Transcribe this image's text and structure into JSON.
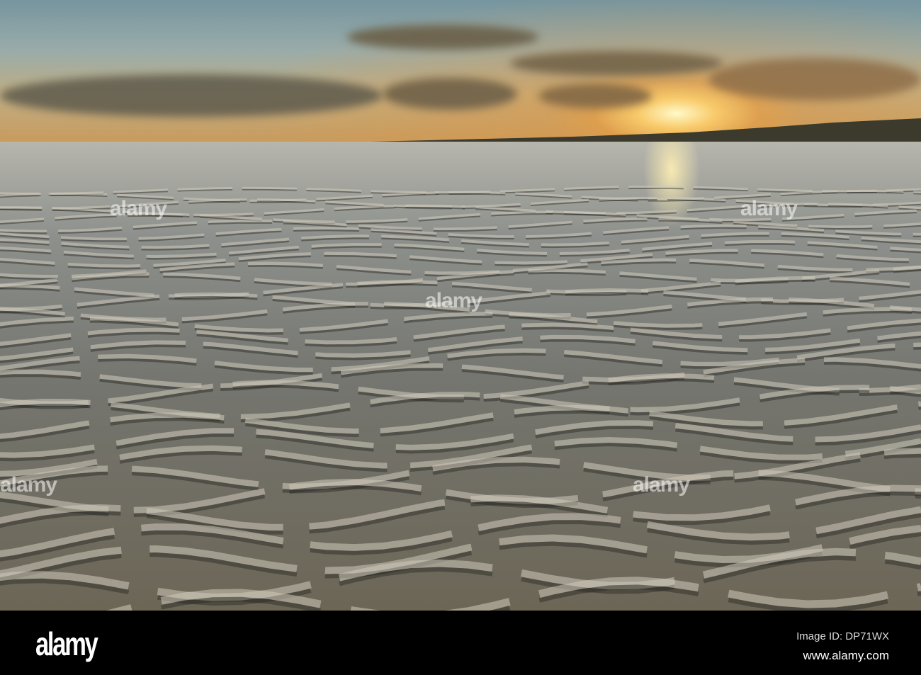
{
  "watermark": {
    "text": "alamy"
  },
  "footer": {
    "logo": "alamy",
    "image_id": "Image ID: DP71WX",
    "url": "www.alamy.com"
  }
}
